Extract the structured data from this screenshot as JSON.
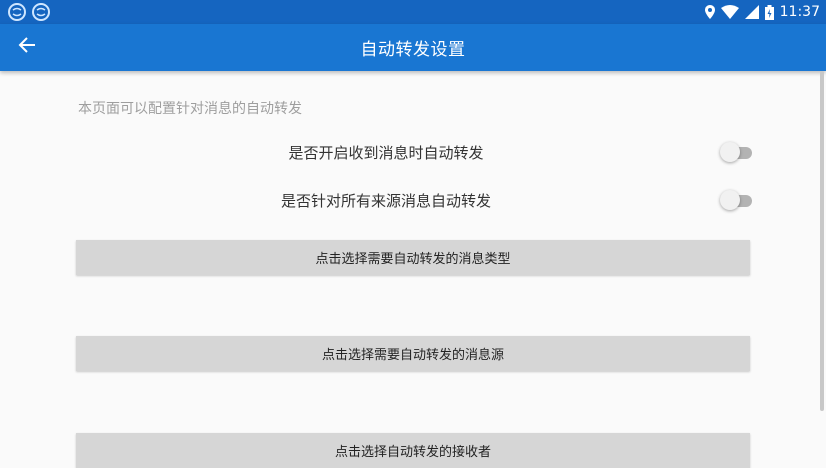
{
  "status_bar": {
    "time": "11:37",
    "icons": [
      "notification-app-icon",
      "notification-app-icon",
      "location-icon",
      "wifi-icon",
      "signal-icon",
      "battery-icon"
    ]
  },
  "app_bar": {
    "title": "自动转发设置",
    "back_icon": "arrow-back-icon"
  },
  "content": {
    "description": "本页面可以配置针对消息的自动转发",
    "settings": [
      {
        "label": "是否开启收到消息时自动转发",
        "enabled": false
      },
      {
        "label": "是否针对所有来源消息自动转发",
        "enabled": false
      }
    ],
    "buttons": [
      {
        "label": "点击选择需要自动转发的消息类型"
      },
      {
        "label": "点击选择需要自动转发的消息源"
      },
      {
        "label": "点击选择自动转发的接收者"
      }
    ]
  },
  "colors": {
    "status_bar": "#1565c0",
    "app_bar": "#1976d2",
    "background": "#fafafa",
    "button": "#d6d6d6"
  }
}
